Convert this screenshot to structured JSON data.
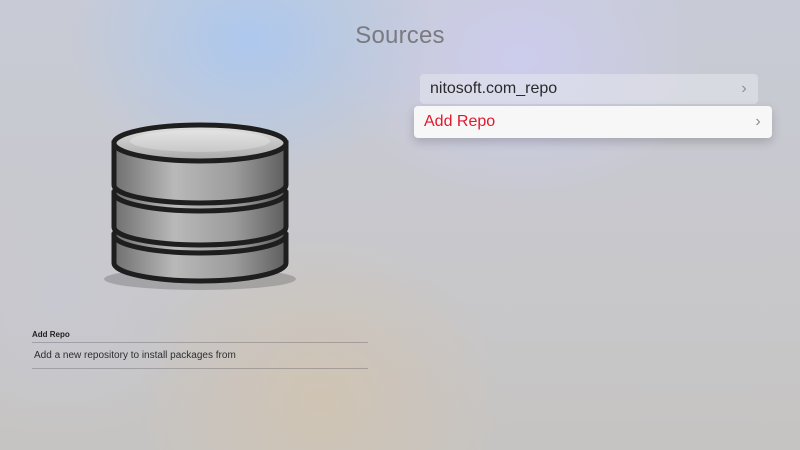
{
  "header": {
    "title": "Sources"
  },
  "sources": {
    "items": [
      {
        "label": "nitosoft.com_repo",
        "icon": "chevron-right-icon",
        "focused": false
      },
      {
        "label": "Add Repo",
        "icon": "chevron-right-icon",
        "focused": true
      }
    ]
  },
  "preview": {
    "icon": "database-icon",
    "title": "Add Repo",
    "description": "Add a new repository to install packages from"
  },
  "colors": {
    "focused_text": "#e0192b",
    "title_text": "#7a7a7f"
  }
}
